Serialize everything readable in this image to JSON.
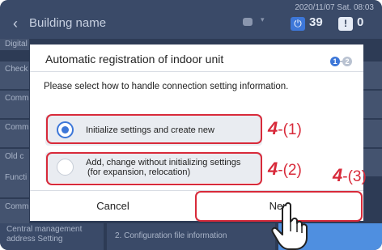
{
  "header": {
    "back_icon": "chevron-left-icon",
    "title": "Building name",
    "datetime": "2020/11/07 Sat. 08:03",
    "power_count": "39",
    "warning_count": "0",
    "power_glyph": "⏻",
    "warning_glyph": "!"
  },
  "background": {
    "items": [
      "Digital",
      "Check",
      "Comm",
      "Comm",
      "Old c",
      "Functi",
      "Comm"
    ],
    "footer_left": "Central management address Setting",
    "footer_mid": "2. Configuration file information"
  },
  "dialog": {
    "title": "Automatic registration of indoor unit",
    "step_current": "1",
    "step_next": "2",
    "instruction": "Please select how to handle connection setting information.",
    "options": [
      {
        "label": "Initialize settings and create new",
        "selected": true
      },
      {
        "label_line1": "Add, change without initializing settings",
        "label_line2": "(for expansion, relocation)",
        "selected": false
      }
    ],
    "cancel_label": "Cancel",
    "next_label": "Next"
  },
  "annotations": {
    "a1_num": "4",
    "a1_suffix": "-(1)",
    "a2_num": "4",
    "a2_suffix": "-(2)",
    "a3_num": "4",
    "a3_suffix": "-(3)"
  },
  "colors": {
    "accent": "#3d77d8",
    "annotation_red": "#d82a3a",
    "background_dark": "#2d3b55"
  }
}
